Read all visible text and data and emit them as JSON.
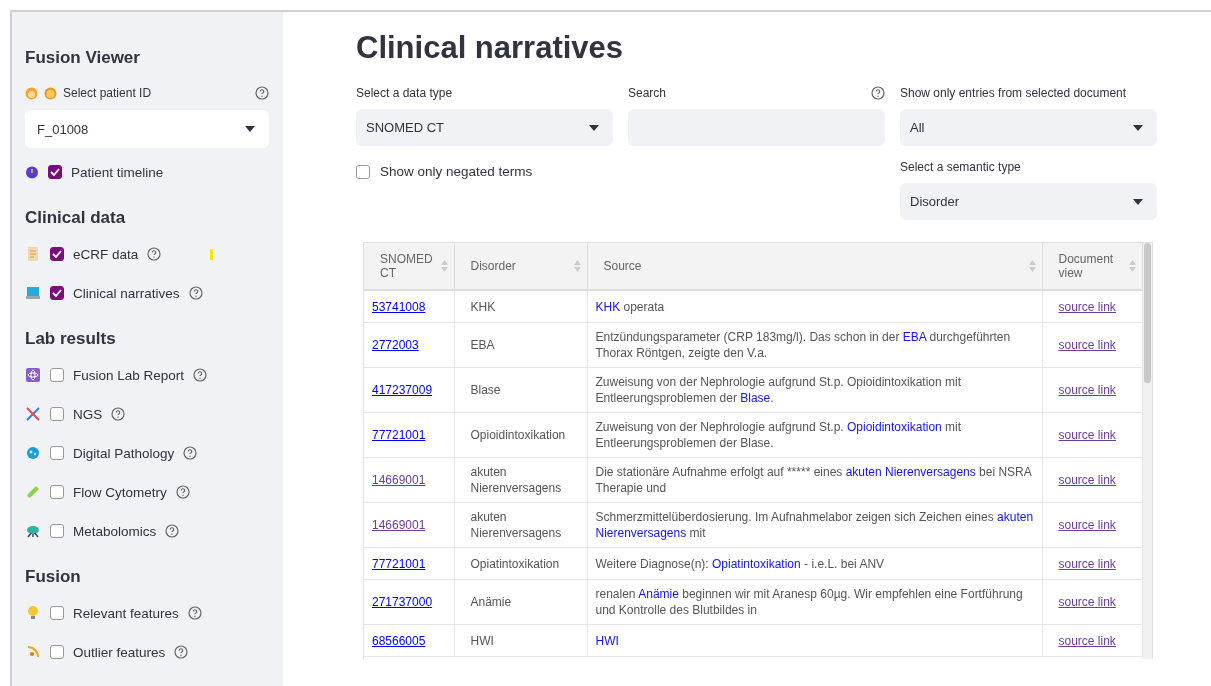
{
  "sidebar": {
    "title": "Fusion Viewer",
    "patient": {
      "label": "Select patient ID",
      "value": "F_01008"
    },
    "timeline": {
      "label": "Patient timeline",
      "checked": true
    },
    "sections": [
      {
        "title": "Clinical data",
        "items": [
          {
            "label": "eCRF data",
            "checked": true
          },
          {
            "label": "Clinical narratives",
            "checked": true
          }
        ]
      },
      {
        "title": "Lab results",
        "items": [
          {
            "label": "Fusion Lab Report",
            "checked": false
          },
          {
            "label": "NGS",
            "checked": false
          },
          {
            "label": "Digital Pathology",
            "checked": false
          },
          {
            "label": "Flow Cytometry",
            "checked": false
          },
          {
            "label": "Metabolomics",
            "checked": false
          }
        ]
      },
      {
        "title": "Fusion",
        "items": [
          {
            "label": "Relevant features",
            "checked": false
          },
          {
            "label": "Outlier features",
            "checked": false
          }
        ]
      }
    ]
  },
  "main": {
    "title": "Clinical narratives",
    "data_type": {
      "label": "Select a data type",
      "value": "SNOMED CT"
    },
    "search": {
      "label": "Search"
    },
    "document": {
      "label": "Show only entries from selected document",
      "value": "All"
    },
    "negated": {
      "label": "Show only negated terms",
      "checked": false
    },
    "semantic": {
      "label": "Select a semantic type",
      "value": "Disorder"
    },
    "table": {
      "columns": [
        "SNOMED CT",
        "Disorder",
        "Source",
        "Document view"
      ],
      "rows": [
        {
          "code": "53741008",
          "visited": false,
          "disorder": "KHK",
          "before": "",
          "term": "KHK",
          "after": " operata",
          "link": "source link"
        },
        {
          "code": "2772003",
          "visited": false,
          "disorder": "EBA",
          "before": "Entzündungsparameter (CRP 183mg/l). Das schon in der ",
          "term": "EBA",
          "after": " durchgeführten Thorax Röntgen, zeigte den V.a.",
          "link": "source link"
        },
        {
          "code": "417237009",
          "visited": false,
          "disorder": "Blase",
          "before": "Zuweisung von der Nephrologie aufgrund St.p. Opioidintoxikation mit Entleerungsproblemen der ",
          "term": "Blase",
          "after": ".",
          "link": "source link"
        },
        {
          "code": "77721001",
          "visited": false,
          "disorder": "Opioidintoxikation",
          "before": "Zuweisung von der Nephrologie aufgrund St.p. ",
          "term": "Opioidintoxikation",
          "after": " mit Entleerungsproblemen der Blase.",
          "link": "source link"
        },
        {
          "code": "14669001",
          "visited": true,
          "disorder": "akuten Nierenversagens",
          "before": "Die stationäre Aufnahme erfolgt auf ***** eines ",
          "term": "akuten Nierenversagens",
          "after": " bei NSRA Therapie und",
          "link": "source link"
        },
        {
          "code": "14669001",
          "visited": true,
          "disorder": "akuten Nierenversagens",
          "before": "Schmerzmittelüberdosierung. Im Aufnahmelabor zeigen sich Zeichen eines ",
          "term": "akuten Nierenversagens",
          "after": " mit",
          "link": "source link"
        },
        {
          "code": "77721001",
          "visited": false,
          "disorder": "Opiatintoxikation",
          "before": "Weitere Diagnose(n): ",
          "term": "Opiatintoxikation",
          "after": " - i.e.L. bei ANV",
          "link": "source link"
        },
        {
          "code": "271737000",
          "visited": false,
          "disorder": "Anämie",
          "before": "renalen ",
          "term": "Anämie",
          "after": " beginnen wir mit Aranesp 60µg. Wir empfehlen eine Fortführung und Kontrolle des Blutbildes in",
          "link": "source link"
        },
        {
          "code": "68566005",
          "visited": false,
          "disorder": "HWI",
          "before": "",
          "term": "HWI",
          "after": "",
          "link": "source link"
        }
      ]
    }
  }
}
